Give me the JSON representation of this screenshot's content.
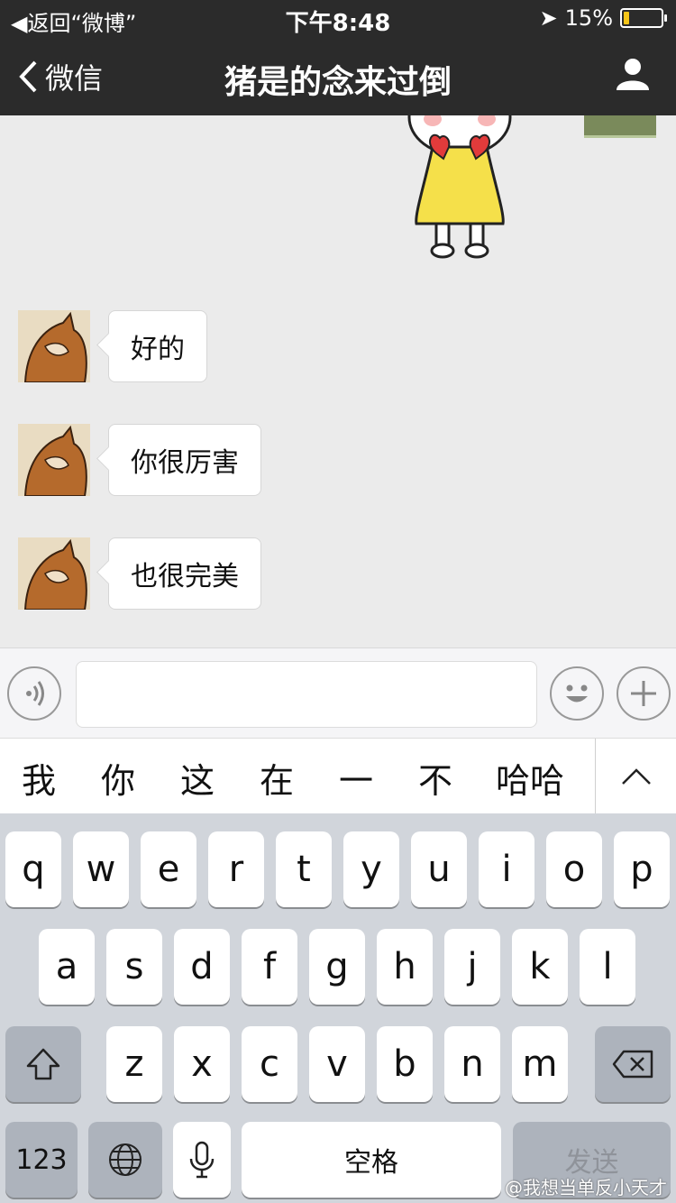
{
  "status_bar": {
    "back_label": "返回“微博”",
    "time": "下午8:48",
    "battery": "15%",
    "battery_level": 0.15
  },
  "nav": {
    "back_label": "微信",
    "title": "猪是的念来过倒"
  },
  "messages": [
    {
      "text": "好的"
    },
    {
      "text": "你很厉害"
    },
    {
      "text": "也很完美"
    }
  ],
  "input": {
    "placeholder": ""
  },
  "candidates": [
    "我",
    "你",
    "这",
    "在",
    "一",
    "不",
    "哈哈"
  ],
  "keyboard": {
    "row1": [
      "q",
      "w",
      "e",
      "r",
      "t",
      "y",
      "u",
      "i",
      "o",
      "p"
    ],
    "row2": [
      "a",
      "s",
      "d",
      "f",
      "g",
      "h",
      "j",
      "k",
      "l"
    ],
    "row3": [
      "z",
      "x",
      "c",
      "v",
      "b",
      "n",
      "m"
    ],
    "num_label": "123",
    "space_label": "空格",
    "send_label": "发送"
  },
  "watermark": "@我想当单反小天才",
  "colors": {
    "navbar": "#2b2b2b",
    "battery": "#f5c518",
    "background": "#ebebeb",
    "keyboard": "#d1d5db"
  }
}
